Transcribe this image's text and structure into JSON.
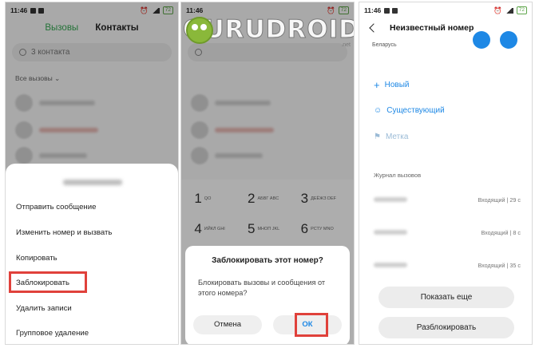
{
  "status": {
    "time": "11:46",
    "battery": "72"
  },
  "screen1": {
    "tabs": {
      "calls": "Вызовы",
      "contacts": "Контакты"
    },
    "search_placeholder": "3 контакта",
    "filter_label": "Все вызовы",
    "menu": [
      {
        "label": "Отправить сообщение"
      },
      {
        "label": "Изменить номер и вызвать"
      },
      {
        "label": "Копировать"
      },
      {
        "label": "Заблокировать"
      },
      {
        "label": "Удалить записи"
      },
      {
        "label": "Групповое удаление"
      }
    ]
  },
  "screen2": {
    "watermark": "GURUDROID",
    "watermark_suffix": ".net",
    "dialpad": [
      {
        "digit": "1",
        "letters": "QO"
      },
      {
        "digit": "2",
        "letters": "АБВГ ABC"
      },
      {
        "digit": "3",
        "letters": "ДЕЁЖЗ DEF"
      },
      {
        "digit": "4",
        "letters": "ИЙКЛ GHI"
      },
      {
        "digit": "5",
        "letters": "МНОП JKL"
      },
      {
        "digit": "6",
        "letters": "РСТУ MNO"
      }
    ],
    "dialog": {
      "title": "Заблокировать этот номер?",
      "message": "Блокировать вызовы и сообщения от этого номера?",
      "cancel": "Отмена",
      "ok": "ОК"
    }
  },
  "screen3": {
    "title": "Неизвестный номер",
    "subtitle": "Беларусь",
    "actions": {
      "new": "Новый",
      "existing": "Существующий",
      "label": "Метка"
    },
    "journal_title": "Журнал вызовов",
    "log": [
      {
        "info": "Входящий | 29 с"
      },
      {
        "info": "Входящий | 8 с"
      },
      {
        "info": "Входящий | 35 с"
      }
    ],
    "show_more": "Показать еще",
    "unblock": "Разблокировать"
  },
  "colors": {
    "accent_green": "#35a853",
    "accent_blue": "#1e88e5",
    "highlight_red": "#e0413b"
  }
}
